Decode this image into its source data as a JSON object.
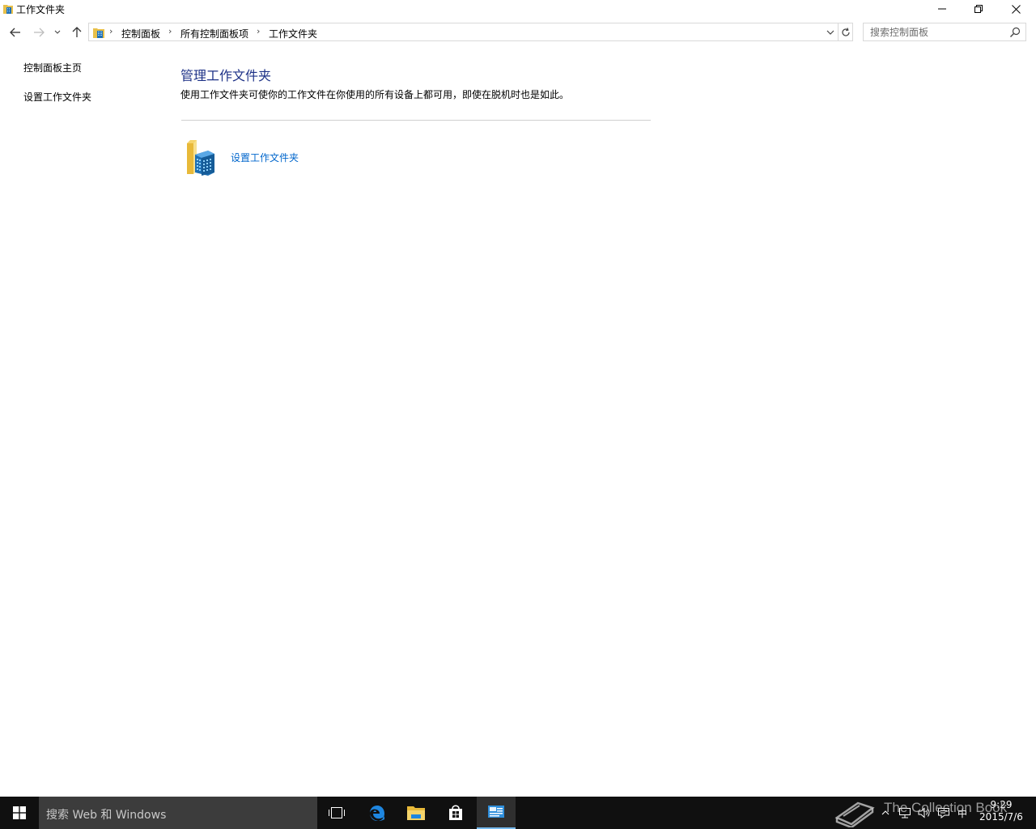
{
  "window": {
    "title": "工作文件夹"
  },
  "nav": {
    "breadcrumbs": [
      "控制面板",
      "所有控制面板项",
      "工作文件夹"
    ],
    "search_placeholder": "搜索控制面板"
  },
  "left_pane": {
    "links": [
      "控制面板主页",
      "设置工作文件夹"
    ]
  },
  "main": {
    "title": "管理工作文件夹",
    "description": "使用工作文件夹可使你的工作文件在你使用的所有设备上都可用，即使在脱机时也是如此。",
    "task_link": "设置工作文件夹"
  },
  "taskbar": {
    "search_placeholder": "搜索 Web 和 Windows",
    "ime": "中",
    "time": "9:29",
    "date": "2015/7/6"
  },
  "watermark": {
    "text": "The Collection Book"
  },
  "colors": {
    "title_blue": "#1e3287",
    "link_blue": "#0066cc",
    "taskbar": "#101010",
    "taskbar_search": "#3c3c3c",
    "active_accent": "#76b9ed"
  }
}
